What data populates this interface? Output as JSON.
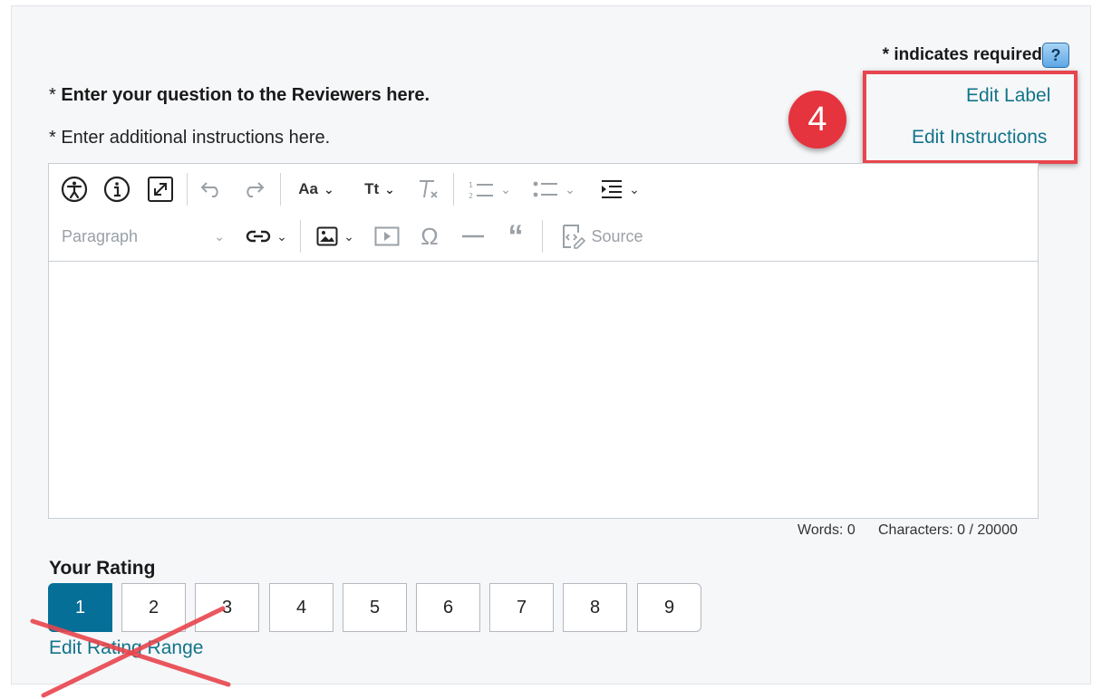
{
  "header": {
    "required_note": "* indicates required",
    "help_label": "?"
  },
  "question": {
    "asterisk": "* ",
    "label": "Enter your question to the Reviewers here.",
    "instructions": "* Enter additional instructions here."
  },
  "links": {
    "edit_label": "Edit Label",
    "edit_instructions": "Edit Instructions",
    "edit_rating_range": "Edit Rating Range"
  },
  "annotation": {
    "step_number": "4",
    "color": "#e5343e"
  },
  "toolbar": {
    "font_size_label": "Aa",
    "font_type_label": "Tt",
    "paragraph_label": "Paragraph",
    "source_label": "Source"
  },
  "counts": {
    "words": "Words: 0",
    "characters": "Characters: 0 / 20000"
  },
  "rating": {
    "title": "Your Rating",
    "options": [
      "1",
      "2",
      "3",
      "4",
      "5",
      "6",
      "7",
      "8",
      "9"
    ],
    "selected": "1",
    "selected_color": "#066f98"
  },
  "colors": {
    "link": "#13748a",
    "highlight": "#e8454e"
  }
}
